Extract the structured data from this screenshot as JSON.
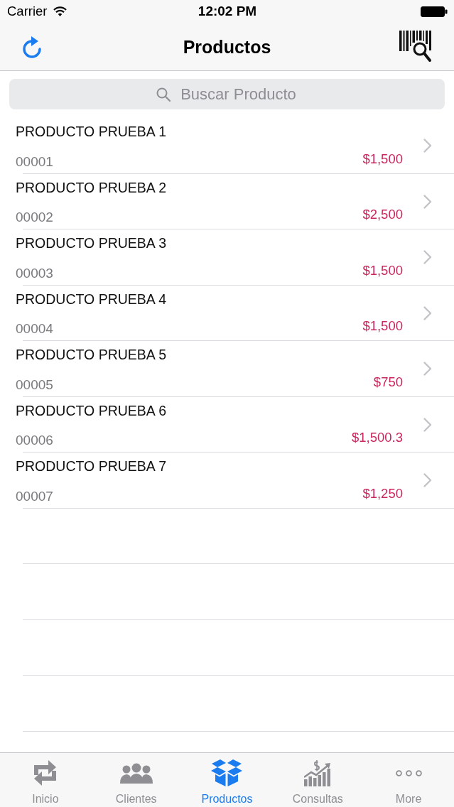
{
  "status_bar": {
    "carrier": "Carrier",
    "time": "12:02 PM"
  },
  "nav_bar": {
    "title": "Productos"
  },
  "search": {
    "placeholder": "Buscar Producto"
  },
  "products": [
    {
      "name": "PRODUCTO PRUEBA 1",
      "code": "00001",
      "price": "$1,500"
    },
    {
      "name": "PRODUCTO PRUEBA 2",
      "code": "00002",
      "price": "$2,500"
    },
    {
      "name": "PRODUCTO PRUEBA 3",
      "code": "00003",
      "price": "$1,500"
    },
    {
      "name": "PRODUCTO PRUEBA 4",
      "code": "00004",
      "price": "$1,500"
    },
    {
      "name": "PRODUCTO PRUEBA 5",
      "code": "00005",
      "price": "$750"
    },
    {
      "name": "PRODUCTO PRUEBA 6",
      "code": "00006",
      "price": "$1,500.3"
    },
    {
      "name": "PRODUCTO PRUEBA 7",
      "code": "00007",
      "price": "$1,250"
    }
  ],
  "tabs": [
    {
      "label": "Inicio",
      "selected": false
    },
    {
      "label": "Clientes",
      "selected": false
    },
    {
      "label": "Productos",
      "selected": true
    },
    {
      "label": "Consultas",
      "selected": false
    },
    {
      "label": "More",
      "selected": false
    }
  ]
}
